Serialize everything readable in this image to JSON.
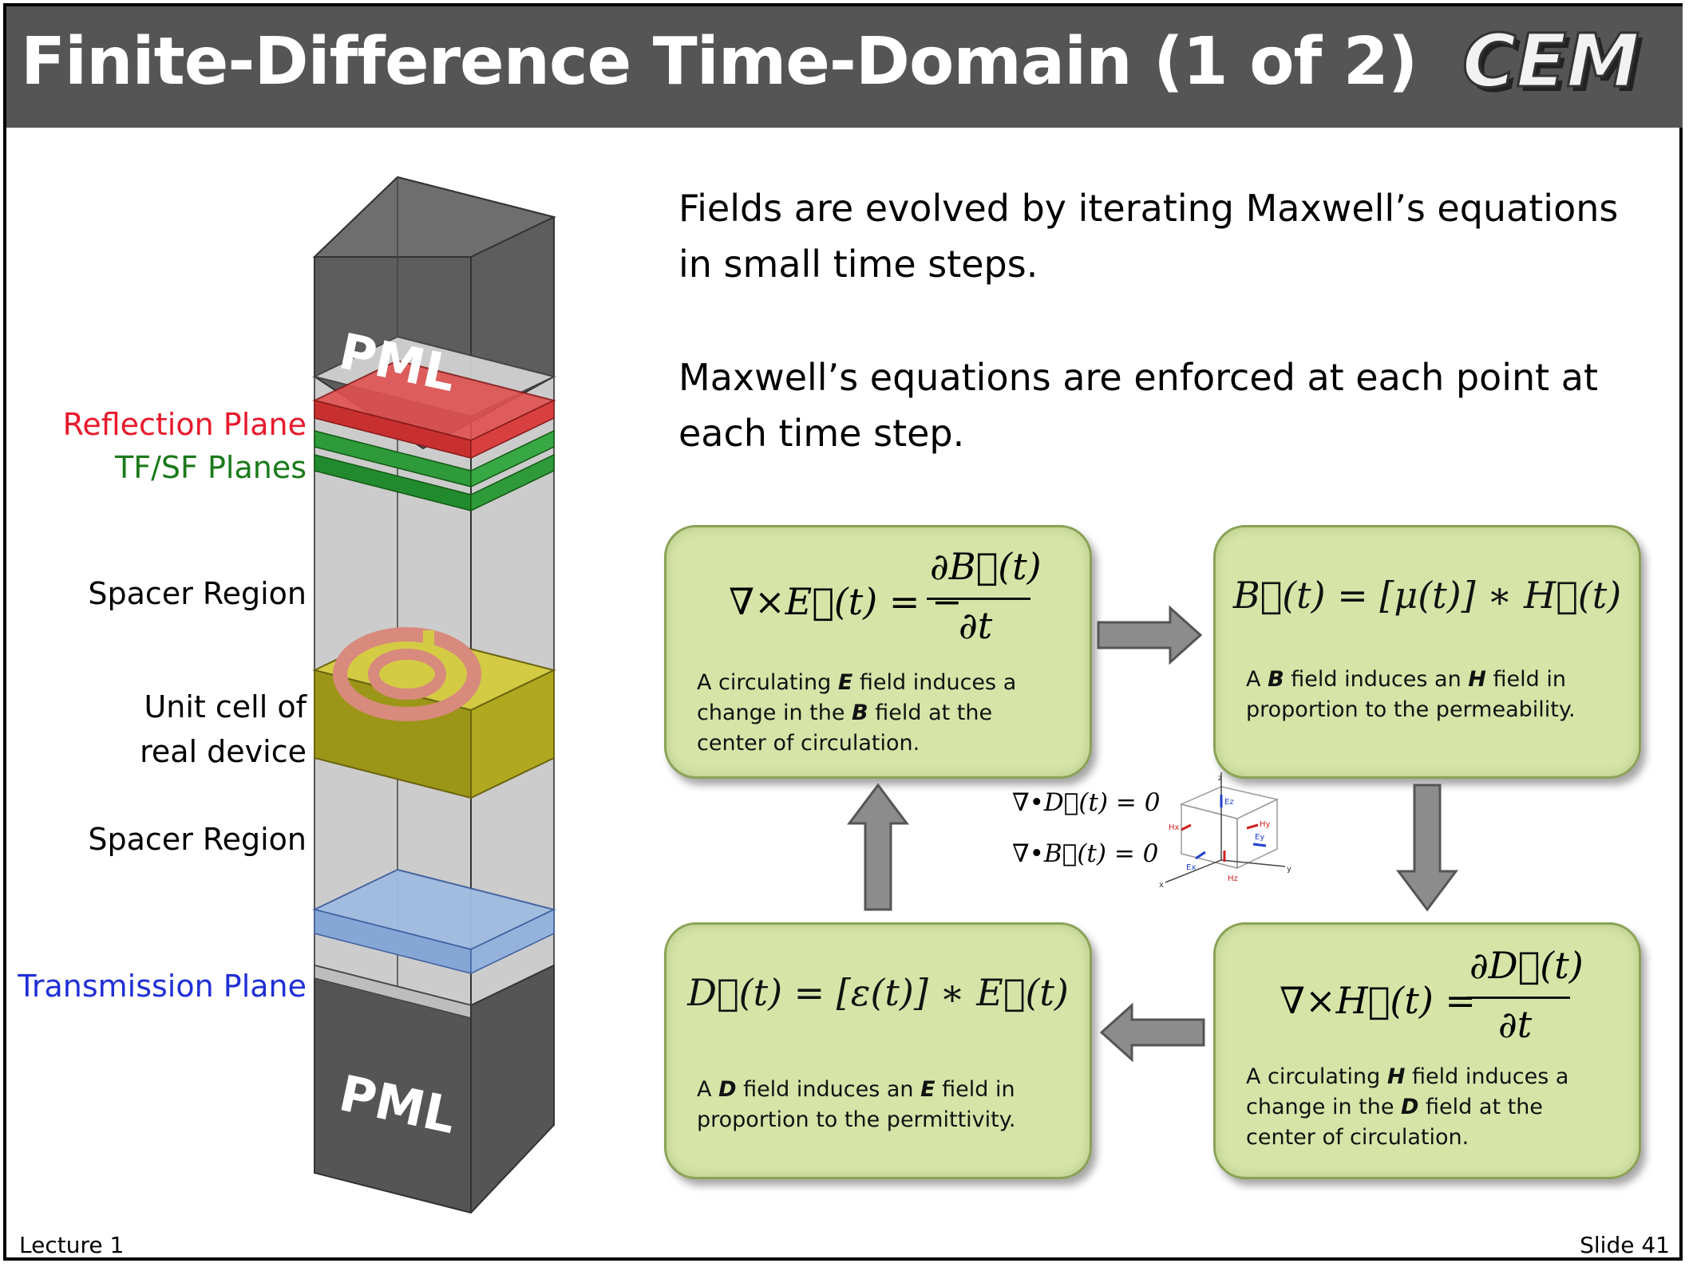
{
  "header": {
    "title": "Finite-Difference Time-Domain (1 of 2)",
    "logo_text": "CEM"
  },
  "body": {
    "paragraph1": "Fields are evolved by iterating Maxwell’s equations in small time steps.",
    "paragraph2": "Maxwell’s equations are enforced at each point at each time step."
  },
  "device": {
    "pml_top": "PML",
    "pml_bottom": "PML",
    "labels": {
      "reflection": "Reflection Plane",
      "tfsf": "TF/SF Planes",
      "spacer1": "Spacer Region",
      "unit_cell_line1": "Unit cell of",
      "unit_cell_line2": "real device",
      "spacer2": "Spacer Region",
      "transmission": "Transmission Plane"
    },
    "colors": {
      "reflection": "#e8192c",
      "tfsf": "#1a7a1a",
      "transmission": "#1f2fd6",
      "pml": "#4a4a4a",
      "spacer": "#c8c8c8",
      "unit_cell": "#b8b020",
      "ring": "#d9897c"
    }
  },
  "cycle": {
    "curl_e": {
      "equation": "∇×E⃗(t) = − ∂B⃗(t) / ∂t",
      "lhs": "∇×E⃗(t) = −",
      "num": "∂B⃗(t)",
      "den": "∂t",
      "desc_pre": "A circulating ",
      "desc_b1": "E",
      "desc_mid": " field induces a change in the ",
      "desc_b2": "B",
      "desc_post": " field at the center of circulation."
    },
    "b_mu_h": {
      "equation": "B⃗(t) = [μ(t)] ∗ H⃗(t)",
      "desc_pre": "A ",
      "desc_b1": "B",
      "desc_mid": " field induces an ",
      "desc_b2": "H",
      "desc_post": " field in proportion to the permeability."
    },
    "curl_h": {
      "equation": "∇×H⃗(t) = ∂D⃗(t) / ∂t",
      "lhs": "∇×H⃗(t) =",
      "num": "∂D⃗(t)",
      "den": "∂t",
      "desc_pre": "A circulating ",
      "desc_b1": "H",
      "desc_mid": " field induces a change in the ",
      "desc_b2": "D",
      "desc_post": " field at the center of circulation."
    },
    "d_eps_e": {
      "equation": "D⃗(t) = [ε(t)] ∗ E⃗(t)",
      "desc_pre": "A ",
      "desc_b1": "D",
      "desc_mid": " field induces an ",
      "desc_b2": "E",
      "desc_post": " field in proportion to the permittivity."
    },
    "divergence": {
      "div_d": "∇•D⃗(t) = 0",
      "div_b": "∇•B⃗(t) = 0"
    },
    "yee_cell_axes": [
      "x",
      "y",
      "z"
    ],
    "yee_cell_labels": [
      "Ez",
      "Ex",
      "Ey",
      "Hx",
      "Hy",
      "Hz"
    ]
  },
  "footer": {
    "left": "Lecture 1",
    "right": "Slide 41"
  }
}
